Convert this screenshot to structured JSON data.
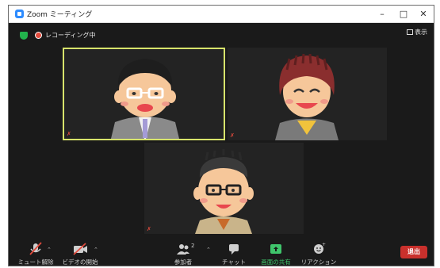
{
  "window": {
    "title": "Zoom ミーティング"
  },
  "top": {
    "recording_text": "レコーディング中",
    "view_label": "表示"
  },
  "colors": {
    "accent_green": "#3fc46b",
    "active_border": "#d7e36b",
    "leave_red": "#c9302c"
  },
  "toolbar": {
    "unmute": "ミュート解除",
    "start_video": "ビデオの開始",
    "participants": "参加者",
    "participants_count": "2",
    "chat": "チャット",
    "share": "画面の共有",
    "reactions": "リアクション",
    "leave": "退出"
  }
}
